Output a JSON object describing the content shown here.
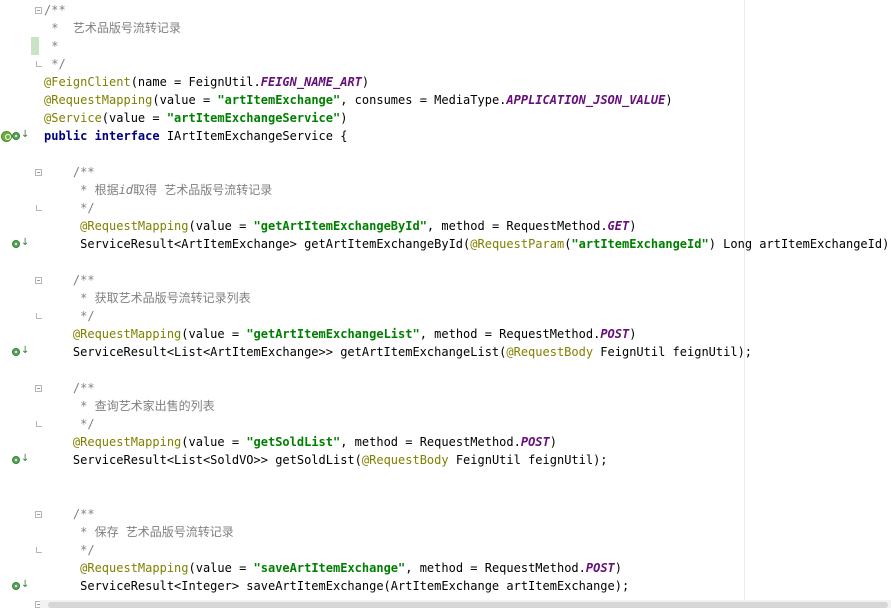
{
  "editor": {
    "lines": [
      [
        [
          "comment",
          "/**"
        ]
      ],
      [
        [
          "comment",
          " *  艺术品版号流转记录"
        ]
      ],
      [
        [
          "comment",
          " *"
        ]
      ],
      [
        [
          "comment",
          " */"
        ]
      ],
      [
        [
          "annotation",
          "@FeignClient"
        ],
        [
          "plain",
          "(name = FeignUtil."
        ],
        [
          "constant",
          "FEIGN_NAME_ART"
        ],
        [
          "plain",
          ")"
        ]
      ],
      [
        [
          "annotation",
          "@RequestMapping"
        ],
        [
          "plain",
          "(value = "
        ],
        [
          "string",
          "\"artItemExchange\""
        ],
        [
          "plain",
          ", consumes = MediaType."
        ],
        [
          "constant",
          "APPLICATION_JSON_VALUE"
        ],
        [
          "plain",
          ")"
        ]
      ],
      [
        [
          "annotation",
          "@Service"
        ],
        [
          "plain",
          "(value = "
        ],
        [
          "string",
          "\"artItemExchangeService\""
        ],
        [
          "plain",
          ")"
        ]
      ],
      [
        [
          "keyword",
          "public interface"
        ],
        [
          "plain",
          " IArtItemExchangeService {"
        ]
      ],
      [],
      [
        [
          "plain",
          "    "
        ],
        [
          "comment",
          "/**"
        ]
      ],
      [
        [
          "comment",
          "     * 根据"
        ],
        [
          "comment-italic",
          "id"
        ],
        [
          "comment",
          "取得 艺术品版号流转记录"
        ]
      ],
      [
        [
          "comment",
          "     */"
        ]
      ],
      [
        [
          "plain",
          "     "
        ],
        [
          "annotation",
          "@RequestMapping"
        ],
        [
          "plain",
          "(value = "
        ],
        [
          "string",
          "\"getArtItemExchangeById\""
        ],
        [
          "plain",
          ", method = RequestMethod."
        ],
        [
          "constant",
          "GET"
        ],
        [
          "plain",
          ")"
        ]
      ],
      [
        [
          "plain",
          "     ServiceResult<ArtItemExchange> getArtItemExchangeById("
        ],
        [
          "annotation",
          "@RequestParam"
        ],
        [
          "plain",
          "("
        ],
        [
          "string",
          "\"artItemExchangeId\""
        ],
        [
          "plain",
          ") Long artItemExchangeId);"
        ]
      ],
      [],
      [
        [
          "plain",
          "    "
        ],
        [
          "comment",
          "/**"
        ]
      ],
      [
        [
          "comment",
          "     * 获取艺术品版号流转记录列表"
        ]
      ],
      [
        [
          "comment",
          "     */"
        ]
      ],
      [
        [
          "plain",
          "    "
        ],
        [
          "annotation",
          "@RequestMapping"
        ],
        [
          "plain",
          "(value = "
        ],
        [
          "string",
          "\"getArtItemExchangeList\""
        ],
        [
          "plain",
          ", method = RequestMethod."
        ],
        [
          "constant",
          "POST"
        ],
        [
          "plain",
          ")"
        ]
      ],
      [
        [
          "plain",
          "    ServiceResult<List<ArtItemExchange>> getArtItemExchangeList("
        ],
        [
          "annotation",
          "@RequestBody"
        ],
        [
          "plain",
          " FeignUtil feignUtil);"
        ]
      ],
      [],
      [
        [
          "plain",
          "    "
        ],
        [
          "comment",
          "/**"
        ]
      ],
      [
        [
          "comment",
          "     * 查询艺术家出售的列表"
        ]
      ],
      [
        [
          "comment",
          "     */"
        ]
      ],
      [
        [
          "plain",
          "    "
        ],
        [
          "annotation",
          "@RequestMapping"
        ],
        [
          "plain",
          "(value = "
        ],
        [
          "string",
          "\"getSoldList\""
        ],
        [
          "plain",
          ", method = RequestMethod."
        ],
        [
          "constant",
          "POST"
        ],
        [
          "plain",
          ")"
        ]
      ],
      [
        [
          "plain",
          "    ServiceResult<List<SoldVO>> getSoldList("
        ],
        [
          "annotation",
          "@RequestBody"
        ],
        [
          "plain",
          " FeignUtil feignUtil);"
        ]
      ],
      [],
      [],
      [
        [
          "plain",
          "    "
        ],
        [
          "comment",
          "/**"
        ]
      ],
      [
        [
          "comment",
          "     * 保存 艺术品版号流转记录"
        ]
      ],
      [
        [
          "comment",
          "     */"
        ]
      ],
      [
        [
          "plain",
          "     "
        ],
        [
          "annotation",
          "@RequestMapping"
        ],
        [
          "plain",
          "(value = "
        ],
        [
          "string",
          "\"saveArtItemExchange\""
        ],
        [
          "plain",
          ", method = RequestMethod."
        ],
        [
          "constant",
          "POST"
        ],
        [
          "plain",
          ")"
        ]
      ],
      [
        [
          "plain",
          "     ServiceResult<Integer> saveArtItemExchange(ArtItemExchange artItemExchange);"
        ]
      ]
    ],
    "colors": {
      "comment": "#808080",
      "keyword": "#000080",
      "annotation": "#808000",
      "string": "#008000",
      "constant": "#660e7a"
    },
    "gutter": {
      "spring_icon": "spring-bean-icon",
      "implementation_icon": "implemented-method-icon"
    }
  }
}
